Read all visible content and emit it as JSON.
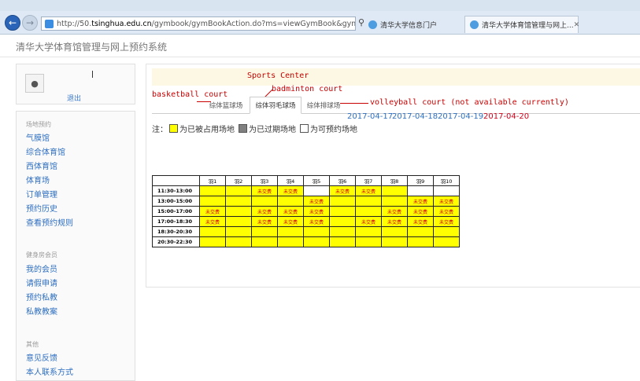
{
  "browser": {
    "url_prefix": "http://50.",
    "url_host": "tsinghua.edu.cn",
    "url_path": "/gymbook/gymBookAction.do?ms=viewGymBook&gymnasium_",
    "tabs": [
      {
        "label": "清华大学信息门户"
      },
      {
        "label": "清华大学体育馆管理与网上..."
      }
    ]
  },
  "site_title": "清华大学体育馆管理与网上预约系统",
  "user": {
    "logout_label": "退出"
  },
  "sidebar": {
    "groups": [
      {
        "label": "场地预约",
        "items": [
          "气膜馆",
          "综合体育馆",
          "西体育馆",
          "体育场",
          "订单管理",
          "预约历史",
          "查看预约规则"
        ]
      },
      {
        "label": "健身房会员",
        "items": [
          "我的会员",
          "请假申请",
          "预约私教",
          "私教教案"
        ]
      },
      {
        "label": "其他",
        "items": [
          "意见反馈",
          "本人联系方式"
        ]
      }
    ]
  },
  "annotations": {
    "sports_center": "Sports Center",
    "basketball": "basketball court",
    "badminton": "badminton court",
    "volleyball": "volleyball court (not available currently)"
  },
  "venue_tabs": [
    "综体篮球场",
    "综体羽毛球场",
    "综体排球场"
  ],
  "dates": [
    "2017-04-17",
    "2017-04-18",
    "2017-04-19",
    "2017-04-20"
  ],
  "selected_date_index": 3,
  "legend": {
    "prefix": "注：",
    "occupied": "为已被占用场地",
    "expired": "为已过期场地",
    "available": "为可预约场地"
  },
  "schedule": {
    "courts": [
      "羽1",
      "羽2",
      "羽3",
      "羽4",
      "羽5",
      "羽6",
      "羽7",
      "羽8",
      "羽9",
      "羽10"
    ],
    "rows": [
      {
        "time": "11:30-13:00",
        "cells": [
          {
            "status": "occupied",
            "text": ""
          },
          {
            "status": "occupied",
            "text": ""
          },
          {
            "status": "occupied",
            "text": "未交费"
          },
          {
            "status": "occupied",
            "text": "未交费"
          },
          {
            "status": "available",
            "text": ""
          },
          {
            "status": "occupied",
            "text": "未交费"
          },
          {
            "status": "occupied",
            "text": "未交费"
          },
          {
            "status": "occupied",
            "text": ""
          },
          {
            "status": "available",
            "text": ""
          },
          {
            "status": "available",
            "text": ""
          }
        ]
      },
      {
        "time": "13:00-15:00",
        "cells": [
          {
            "status": "occupied",
            "text": ""
          },
          {
            "status": "occupied",
            "text": ""
          },
          {
            "status": "occupied",
            "text": ""
          },
          {
            "status": "occupied",
            "text": ""
          },
          {
            "status": "occupied",
            "text": "未交费"
          },
          {
            "status": "occupied",
            "text": ""
          },
          {
            "status": "occupied",
            "text": ""
          },
          {
            "status": "occupied",
            "text": ""
          },
          {
            "status": "occupied",
            "text": "未交费"
          },
          {
            "status": "occupied",
            "text": "未交费"
          }
        ]
      },
      {
        "time": "15:00-17:00",
        "cells": [
          {
            "status": "occupied",
            "text": "未交费"
          },
          {
            "status": "occupied",
            "text": ""
          },
          {
            "status": "occupied",
            "text": "未交费"
          },
          {
            "status": "occupied",
            "text": "未交费"
          },
          {
            "status": "occupied",
            "text": "未交费"
          },
          {
            "status": "occupied",
            "text": ""
          },
          {
            "status": "occupied",
            "text": ""
          },
          {
            "status": "occupied",
            "text": "未交费"
          },
          {
            "status": "occupied",
            "text": "未交费"
          },
          {
            "status": "occupied",
            "text": "未交费"
          }
        ]
      },
      {
        "time": "17:00-18:30",
        "cells": [
          {
            "status": "occupied",
            "text": "未交费"
          },
          {
            "status": "occupied",
            "text": ""
          },
          {
            "status": "occupied",
            "text": "未交费"
          },
          {
            "status": "occupied",
            "text": "未交费"
          },
          {
            "status": "occupied",
            "text": "未交费"
          },
          {
            "status": "occupied",
            "text": ""
          },
          {
            "status": "occupied",
            "text": "未交费"
          },
          {
            "status": "occupied",
            "text": "未交费"
          },
          {
            "status": "occupied",
            "text": "未交费"
          },
          {
            "status": "occupied",
            "text": "未交费"
          }
        ]
      },
      {
        "time": "18:30-20:30",
        "cells": [
          {
            "status": "occupied",
            "text": ""
          },
          {
            "status": "occupied",
            "text": ""
          },
          {
            "status": "occupied",
            "text": ""
          },
          {
            "status": "occupied",
            "text": ""
          },
          {
            "status": "occupied",
            "text": ""
          },
          {
            "status": "occupied",
            "text": ""
          },
          {
            "status": "occupied",
            "text": ""
          },
          {
            "status": "occupied",
            "text": ""
          },
          {
            "status": "occupied",
            "text": ""
          },
          {
            "status": "occupied",
            "text": ""
          }
        ]
      },
      {
        "time": "20:30-22:30",
        "cells": [
          {
            "status": "occupied",
            "text": ""
          },
          {
            "status": "occupied",
            "text": ""
          },
          {
            "status": "occupied",
            "text": ""
          },
          {
            "status": "occupied",
            "text": ""
          },
          {
            "status": "occupied",
            "text": ""
          },
          {
            "status": "occupied",
            "text": ""
          },
          {
            "status": "occupied",
            "text": ""
          },
          {
            "status": "occupied",
            "text": ""
          },
          {
            "status": "occupied",
            "text": ""
          },
          {
            "status": "occupied",
            "text": ""
          }
        ]
      }
    ]
  },
  "colors": {
    "occupied": "#ffff00",
    "expired": "#808080",
    "available": "#ffffff",
    "annotation": "#c80000",
    "link": "#2e6fc0",
    "selected_date": "#d0021b"
  }
}
